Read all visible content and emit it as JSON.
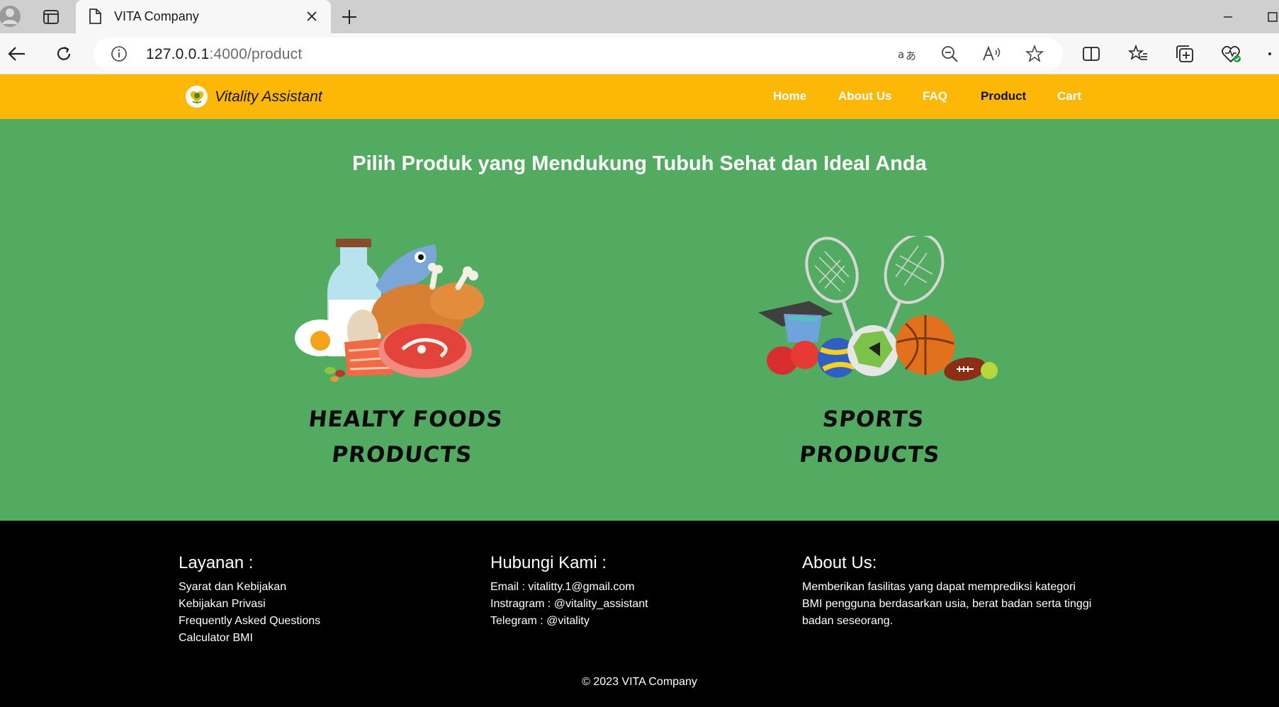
{
  "browser": {
    "tab_title": "VITA Company",
    "url_host": "127.0.0.1",
    "url_path": ":4000/product",
    "icons": [
      "profile-icon",
      "tab-actions-icon",
      "page-icon",
      "close-icon",
      "new-tab-icon",
      "minimize-icon",
      "maximize-icon",
      "back-icon",
      "refresh-icon",
      "site-info-icon",
      "translate-icon",
      "zoom-out-icon",
      "read-aloud-icon",
      "favorite-star-icon",
      "split-screen-icon",
      "favorites-icon",
      "collections-icon",
      "browser-essentials-icon",
      "more-icon"
    ]
  },
  "navbar": {
    "brand": "Vitality Assistant",
    "links": [
      "Home",
      "About Us",
      "FAQ",
      "Product",
      "Cart"
    ],
    "active": "Product",
    "bg_color": "#fdb707"
  },
  "hero": {
    "title": "Pilih Produk yang Mendukung Tubuh Sehat dan Ideal Anda",
    "bg_color": "#53ab62",
    "products": [
      {
        "line1": "HEALTY FOODS",
        "line2": "PRODUCTS"
      },
      {
        "line1": "SPORTS",
        "line2": "PRODUCTS"
      }
    ]
  },
  "footer": {
    "layanan": {
      "title": "Layanan :",
      "items": [
        "Syarat dan Kebijakan",
        "Kebijakan Privasi",
        "Frequently Asked Questions",
        "Calculator BMI"
      ]
    },
    "hubungi": {
      "title": "Hubungi Kami :",
      "items": [
        "Email : vitalitty.1@gmail.com",
        "Instragram : @vitality_assistant",
        "Telegram : @vitality"
      ]
    },
    "about": {
      "title": "About Us:",
      "lines": [
        "Memberikan fasilitas yang dapat memprediksi kategori",
        "BMI pengguna berdasarkan usia, berat badan serta tinggi",
        "badan seseorang."
      ]
    },
    "copyright": "© 2023 VITA Company"
  }
}
